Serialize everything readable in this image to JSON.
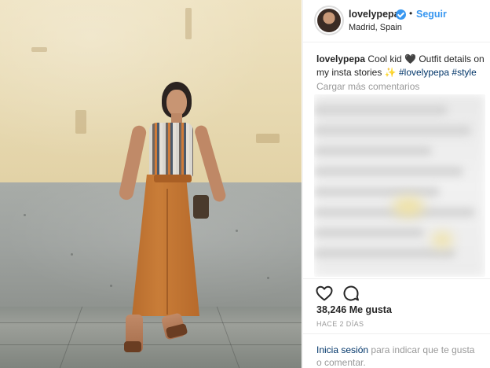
{
  "post": {
    "username": "lovelypepa",
    "follow_label": "Seguir",
    "separator": "•",
    "location": "Madrid, Spain",
    "caption": {
      "user": "lovelypepa",
      "text": "Cool kid 🖤 Outfit details on my insta stories ✨",
      "hashtags": [
        "#lovelypepa",
        "#style"
      ]
    },
    "load_more_label": "Cargar más comentarios",
    "likes_count": "38,246",
    "likes_label": "Me gusta",
    "time_ago": "HACE 2 DÍAS",
    "footer": {
      "login_label": "Inicia sesión",
      "rest_text": "para indicar que te gusta o comentar."
    }
  },
  "icons": {
    "verified": "verified-badge-icon",
    "like": "heart-icon",
    "comment": "comment-icon"
  },
  "colors": {
    "link_blue": "#3897f0",
    "hashtag_blue": "#003569",
    "muted_gray": "#999999",
    "text": "#262626"
  }
}
